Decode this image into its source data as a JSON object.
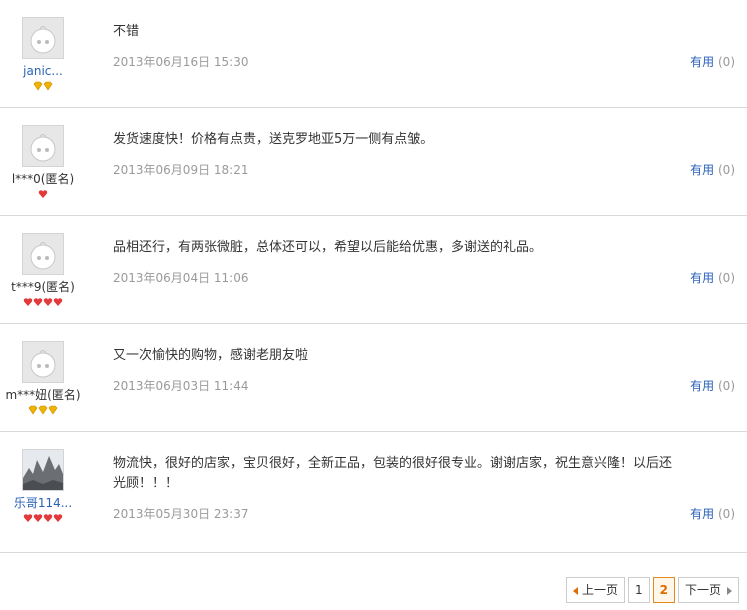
{
  "reviews": [
    {
      "user": "janic...",
      "user_is_link": true,
      "badge": "gold",
      "badge_count": 2,
      "content": "不错",
      "date": "2013年06月16日 15:30",
      "useful_label": "有用",
      "useful_count": "(0)"
    },
    {
      "user": "l***0(匿名)",
      "user_is_link": false,
      "badge": "red",
      "badge_count": 1,
      "content": "发货速度快！价格有点贵，送克罗地亚5万一侧有点皱。",
      "date": "2013年06月09日 18:21",
      "useful_label": "有用",
      "useful_count": "(0)"
    },
    {
      "user": "t***9(匿名)",
      "user_is_link": false,
      "badge": "red",
      "badge_count": 4,
      "content": "品相还行，有两张微脏，总体还可以，希望以后能给优惠，多谢送的礼品。",
      "date": "2013年06月04日 11:06",
      "useful_label": "有用",
      "useful_count": "(0)"
    },
    {
      "user": "m***妞(匿名)",
      "user_is_link": false,
      "badge": "gold",
      "badge_count": 3,
      "content": "又一次愉快的购物，感谢老朋友啦",
      "date": "2013年06月03日 11:44",
      "useful_label": "有用",
      "useful_count": "(0)"
    },
    {
      "user": "乐哥114...",
      "user_is_link": true,
      "badge": "red",
      "badge_count": 4,
      "content": "物流快，很好的店家，宝贝很好，全新正品，包装的很好很专业。谢谢店家，祝生意兴隆！以后还光顾！！！",
      "date": "2013年05月30日 23:37",
      "useful_label": "有用",
      "useful_count": "(0)"
    }
  ],
  "pager": {
    "prev": "上一页",
    "pages": [
      "1",
      "2"
    ],
    "current": "2",
    "next": "下一页"
  },
  "colors": {
    "link": "#2a62b8",
    "date": "#9a9a9a",
    "current_page": "#e06b00",
    "gold_badge": "#f0b400",
    "red_badge": "#e23a3a"
  }
}
